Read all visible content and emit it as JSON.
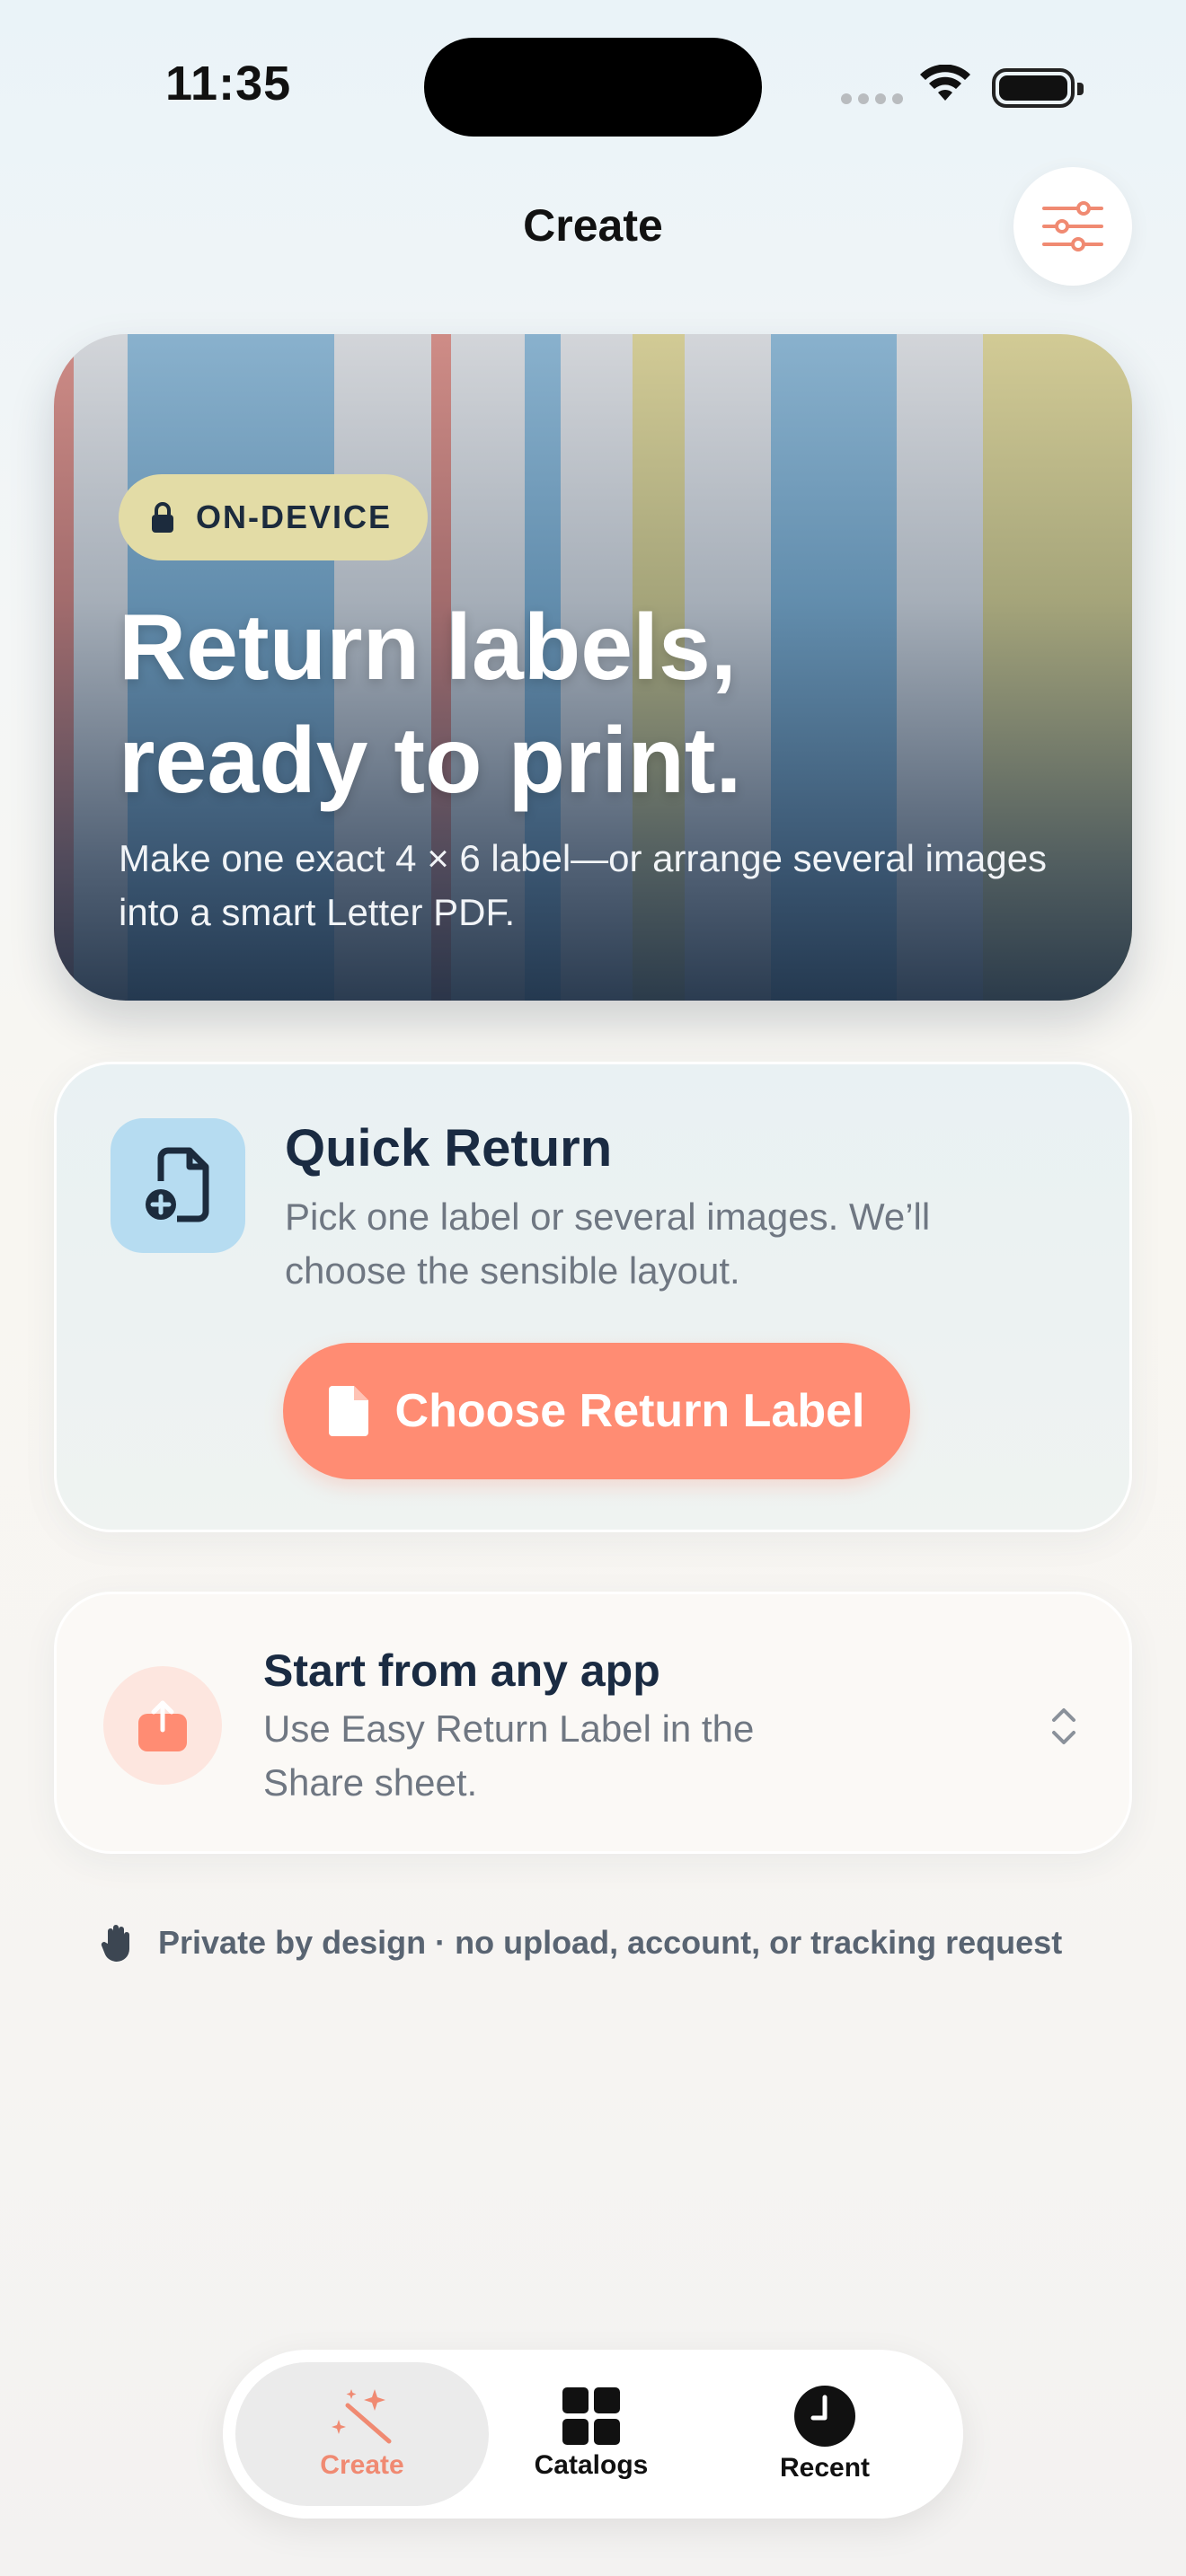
{
  "status_bar": {
    "time": "11:35"
  },
  "nav": {
    "title": "Create",
    "settings_icon": "sliders-icon"
  },
  "hero": {
    "badge": "ON-DEVICE",
    "title_line1": "Return labels,",
    "title_line2": "ready to print.",
    "subtitle": "Make one exact 4 × 6 label—or arrange several images into a smart Letter PDF."
  },
  "quick_return": {
    "title": "Quick Return",
    "description": "Pick one label or several images. We’ll choose the sensible layout.",
    "button_label": "Choose Return Label"
  },
  "share": {
    "title": "Start from any app",
    "description": "Use Easy Return Label in the Share sheet."
  },
  "privacy": {
    "text": "Private by design · no upload, account, or tracking request"
  },
  "tabs": [
    {
      "label": "Create",
      "icon": "magic-wand-icon",
      "selected": true
    },
    {
      "label": "Catalogs",
      "icon": "grid-icon",
      "selected": false
    },
    {
      "label": "Recent",
      "icon": "clock-icon",
      "selected": false
    }
  ],
  "colors": {
    "accent": "#ff8c73",
    "title": "#1a2b42",
    "badge": "#e3dca6",
    "doc_tile": "#b6dcf1"
  }
}
